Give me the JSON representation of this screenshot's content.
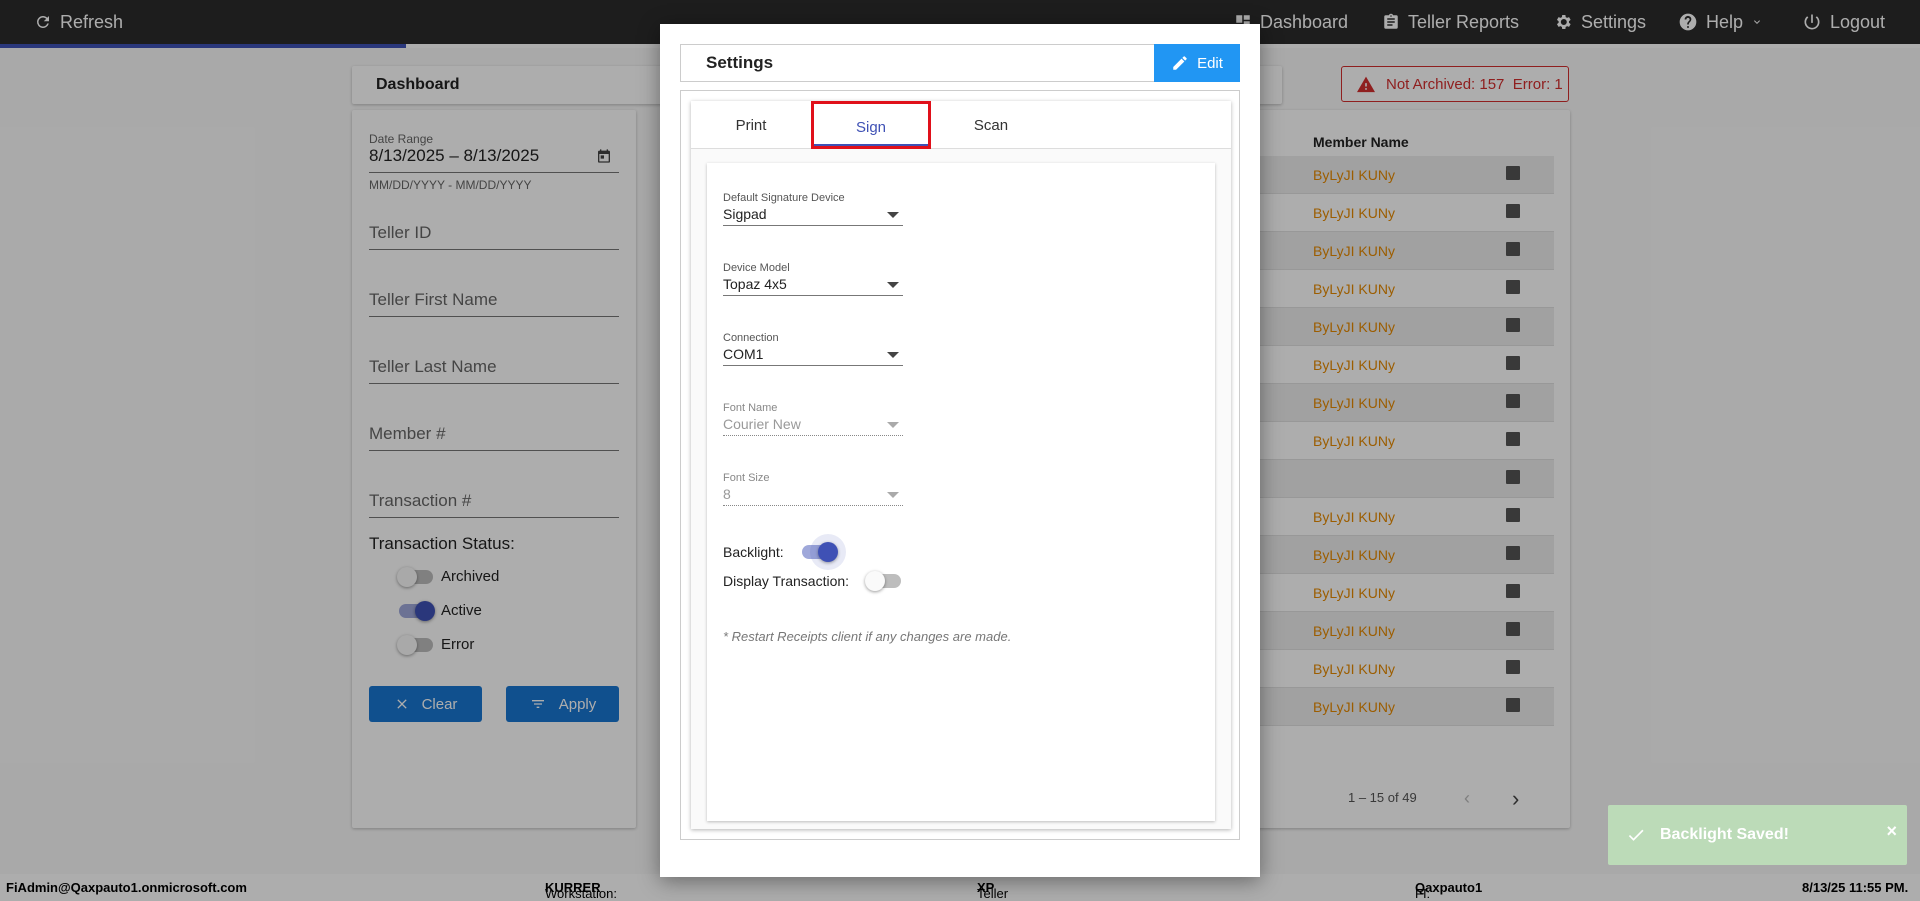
{
  "topbar": {
    "refresh_label": "Refresh",
    "dashboard_label": "Dashboard",
    "teller_reports_label": "Teller Reports",
    "settings_label": "Settings",
    "help_label": "Help",
    "logout_label": "Logout"
  },
  "page": {
    "title": "Dashboard",
    "warning": "Not Archived: 157  Error: 1"
  },
  "filters": {
    "date_range_label": "Date Range",
    "date_range_value": "8/13/2025 – 8/13/2025",
    "date_hint": "MM/DD/YYYY - MM/DD/YYYY",
    "teller_id": "Teller ID",
    "teller_first_name": "Teller First Name",
    "teller_last_name": "Teller Last Name",
    "member_no": "Member #",
    "transaction_no": "Transaction #",
    "status_title": "Transaction Status:",
    "statuses": [
      {
        "label": "Archived",
        "on": false
      },
      {
        "label": "Active",
        "on": true
      },
      {
        "label": "Error",
        "on": false
      }
    ],
    "clear_label": "Clear",
    "apply_label": "Apply"
  },
  "table": {
    "member_name_header": "Member Name",
    "rows": [
      "ByLyJI KUNy",
      "ByLyJI KUNy",
      "ByLyJI KUNy",
      "ByLyJI KUNy",
      "ByLyJI KUNy",
      "ByLyJI KUNy",
      "ByLyJI KUNy",
      "ByLyJI KUNy",
      "",
      "ByLyJI KUNy",
      "ByLyJI KUNy",
      "ByLyJI KUNy",
      "ByLyJI KUNy",
      "ByLyJI KUNy",
      "ByLyJI KUNy"
    ],
    "pager": "1 – 15 of 49"
  },
  "modal": {
    "title": "Settings",
    "edit_label": "Edit",
    "tabs": [
      "Print",
      "Sign",
      "Scan"
    ],
    "active_tab": "Sign",
    "fields": {
      "signature_device_label": "Default Signature Device",
      "signature_device_value": "Sigpad",
      "device_model_label": "Device Model",
      "device_model_value": "Topaz 4x5",
      "connection_label": "Connection",
      "connection_value": "COM1",
      "font_name_label": "Font Name",
      "font_name_value": "Courier New",
      "font_size_label": "Font Size",
      "font_size_value": "8"
    },
    "backlight_label": "Backlight:",
    "backlight_on": true,
    "display_transaction_label": "Display Transaction:",
    "display_transaction_on": false,
    "note": "* Restart Receipts client if any changes are made."
  },
  "toast": {
    "message": "Backlight Saved!",
    "close": "×"
  },
  "status_bar": {
    "user": "FiAdmin@Qaxpauto1.onmicrosoft.com",
    "workstation_key": "Workstation:",
    "workstation_value": "KURRER",
    "platform_key": "Teller Platform:",
    "platform_value": "XP",
    "fi_key": "FI:",
    "fi_value": "Qaxpauto1",
    "datetime": "8/13/25 11:55 PM."
  },
  "colors": {
    "accent": "#3f51b5",
    "button_blue": "#1976d2",
    "edit_blue": "#2196f3",
    "warning_red": "#d32f2f",
    "member_orange": "#e68a00",
    "toast_green": "#bcdbb8"
  }
}
